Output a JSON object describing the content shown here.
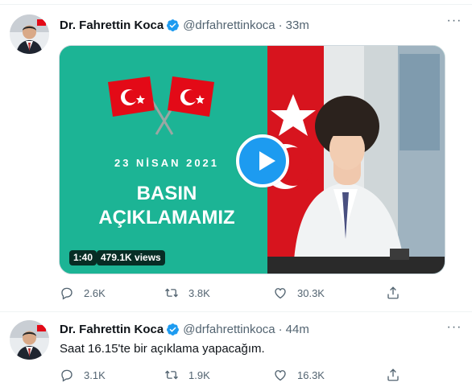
{
  "tweets": [
    {
      "name": "Dr. Fahrettin Koca",
      "handle": "@drfahrettinkoca",
      "separator": "·",
      "time": "33m",
      "text": "",
      "media": {
        "date_text": "23 NİSAN 2021",
        "title_line1": "BASIN",
        "title_line2": "AÇIKLAMAMIZ",
        "duration": "1:40",
        "views": "479.1K views",
        "icon": "play-icon"
      },
      "replies": "2.6K",
      "retweets": "3.8K",
      "likes": "30.3K"
    },
    {
      "name": "Dr. Fahrettin Koca",
      "handle": "@drfahrettinkoca",
      "separator": "·",
      "time": "44m",
      "text": "Saat 16.15'te bir açıklama yapacağım.",
      "replies": "3.1K",
      "retweets": "1.9K",
      "likes": "16.3K"
    }
  ],
  "icons": [
    "reply-icon",
    "retweet-icon",
    "like-icon",
    "share-icon",
    "verified-icon",
    "more-icon",
    "play-icon"
  ],
  "colors": {
    "accent": "#1d9bf0",
    "muted": "#536471",
    "media_bg": "#1cb495",
    "flag_red": "#e30a17"
  },
  "more_glyph": "···"
}
